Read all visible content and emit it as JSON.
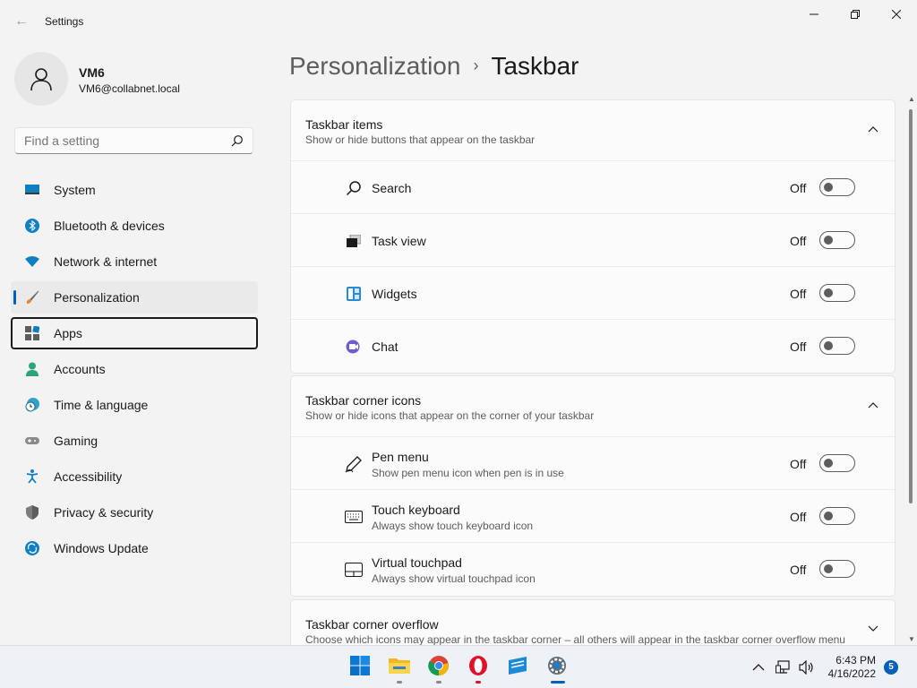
{
  "window": {
    "title": "Settings",
    "back_glyph": "←"
  },
  "profile": {
    "name": "VM6",
    "email": "VM6@collabnet.local"
  },
  "search": {
    "placeholder": "Find a setting"
  },
  "sidebar": {
    "items": [
      {
        "label": "System",
        "icon": "system-icon"
      },
      {
        "label": "Bluetooth & devices",
        "icon": "bluetooth-icon"
      },
      {
        "label": "Network & internet",
        "icon": "wifi-icon"
      },
      {
        "label": "Personalization",
        "icon": "brush-icon",
        "selected": true
      },
      {
        "label": "Apps",
        "icon": "apps-icon",
        "focused": true
      },
      {
        "label": "Accounts",
        "icon": "accounts-icon"
      },
      {
        "label": "Time & language",
        "icon": "clock-globe-icon"
      },
      {
        "label": "Gaming",
        "icon": "gamepad-icon"
      },
      {
        "label": "Accessibility",
        "icon": "accessibility-icon"
      },
      {
        "label": "Privacy & security",
        "icon": "shield-icon"
      },
      {
        "label": "Windows Update",
        "icon": "update-icon"
      }
    ]
  },
  "breadcrumb": {
    "parent": "Personalization",
    "separator": "›",
    "current": "Taskbar"
  },
  "sections": [
    {
      "title": "Taskbar items",
      "subtitle": "Show or hide buttons that appear on the taskbar",
      "rows": [
        {
          "label": "Search",
          "state": "Off",
          "icon": "search-icon"
        },
        {
          "label": "Task view",
          "state": "Off",
          "icon": "task-view-icon"
        },
        {
          "label": "Widgets",
          "state": "Off",
          "icon": "widgets-icon"
        },
        {
          "label": "Chat",
          "state": "Off",
          "icon": "chat-icon"
        }
      ]
    },
    {
      "title": "Taskbar corner icons",
      "subtitle": "Show or hide icons that appear on the corner of your taskbar",
      "rows": [
        {
          "label": "Pen menu",
          "sub": "Show pen menu icon when pen is in use",
          "state": "Off",
          "icon": "pen-icon"
        },
        {
          "label": "Touch keyboard",
          "sub": "Always show touch keyboard icon",
          "state": "Off",
          "icon": "keyboard-icon"
        },
        {
          "label": "Virtual touchpad",
          "sub": "Always show virtual touchpad icon",
          "state": "Off",
          "icon": "touchpad-icon"
        }
      ]
    },
    {
      "title": "Taskbar corner overflow",
      "subtitle": "Choose which icons may appear in the taskbar corner – all others will appear in the taskbar corner overflow menu"
    }
  ],
  "taskbar": {
    "apps": [
      "start-icon",
      "file-explorer-icon",
      "chrome-icon",
      "opera-icon",
      "store-icon",
      "settings-app-icon"
    ],
    "clock": {
      "time": "6:43 PM",
      "date": "4/16/2022"
    },
    "notifications": "5"
  },
  "colors": {
    "accent": "#005fb8",
    "background": "#f3f3f3",
    "card": "#fbfbfb"
  }
}
